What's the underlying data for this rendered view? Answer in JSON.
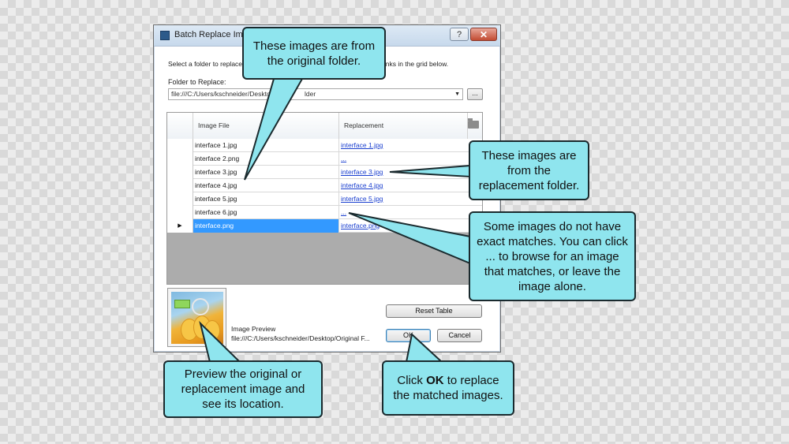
{
  "dialog": {
    "title": "Batch Replace Image",
    "help_label": "?",
    "close_label": "✕",
    "instruction_left": "Select a folder to replace",
    "instruction_right": "links in the grid below.",
    "folder_label": "Folder to Replace:",
    "folder_value_left": "file:///C:/Users/kschneider/Desktop/",
    "folder_value_right": "lder",
    "browse_label": "...",
    "grid": {
      "columns": [
        "Image File",
        "Replacement"
      ],
      "rows": [
        {
          "file": "interface 1.jpg",
          "replacement": "interface 1.jpg",
          "indicator": ""
        },
        {
          "file": "interface 2.png",
          "replacement": "...",
          "indicator": ""
        },
        {
          "file": "interface 3.jpg",
          "replacement": "interface 3.jpg",
          "indicator": ""
        },
        {
          "file": "interface 4.jpg",
          "replacement": "interface 4.jpg",
          "indicator": ""
        },
        {
          "file": "interface 5.jpg",
          "replacement": "interface 5.jpg",
          "indicator": ""
        },
        {
          "file": "interface 6.jpg",
          "replacement": "...",
          "indicator": ""
        },
        {
          "file": "interface.png",
          "replacement": "interface.png",
          "indicator": "▶"
        }
      ]
    },
    "reset_label": "Reset Table",
    "preview_label": "Image Preview",
    "preview_path": "file:///C:/Users/kschneider/Desktop/Original F...",
    "ok_label": "OK",
    "cancel_label": "Cancel"
  },
  "callouts": {
    "original": "These images are from the original folder.",
    "replacement": "These images are from the replacement folder.",
    "browse": "Some images do not have exact matches. You can click ... to browse for an image that matches, or leave the image alone.",
    "preview": "Preview the original or replacement image and see its location.",
    "ok_prefix": "Click ",
    "ok_bold": "OK",
    "ok_suffix": " to replace the matched images."
  },
  "colors": {
    "callout_fill": "#8fe5ee",
    "selected_row": "#3399ff",
    "link": "#1a3fcf"
  }
}
